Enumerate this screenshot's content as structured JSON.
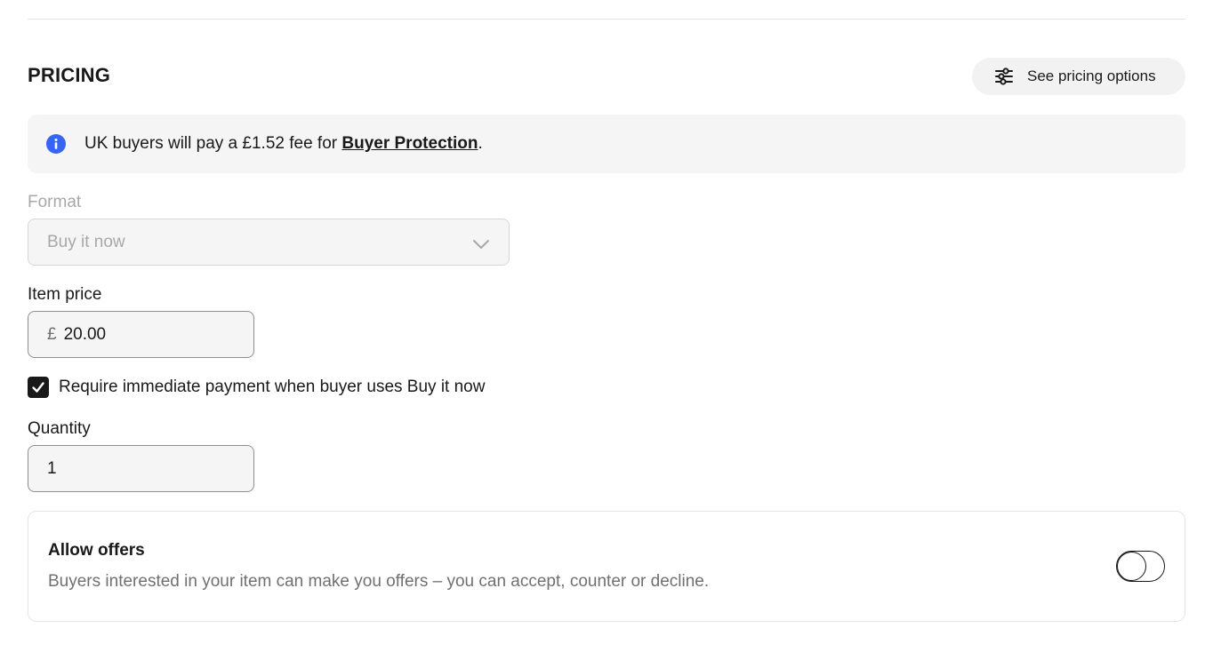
{
  "section": {
    "title": "PRICING",
    "pricing_options_label": "See pricing options",
    "pricing_options_icon": "sliders-icon"
  },
  "banner": {
    "icon": "info-icon",
    "text_before": "UK buyers will pay a £1.52 fee for ",
    "link_text": "Buyer Protection",
    "text_after": "."
  },
  "format": {
    "label": "Format",
    "value": "Buy it now",
    "icon": "chevron-down-icon"
  },
  "item_price": {
    "label": "Item price",
    "currency": "£",
    "value": "20.00"
  },
  "immediate_payment": {
    "label": "Require immediate payment when buyer uses Buy it now",
    "checked": true
  },
  "quantity": {
    "label": "Quantity",
    "value": "1"
  },
  "offers": {
    "title": "Allow offers",
    "description": "Buyers interested in your item can make you offers – you can accept, counter or decline.",
    "enabled": false
  },
  "colors": {
    "info_blue": "#3665f3",
    "text_primary": "#191919",
    "text_secondary": "#707070",
    "disabled": "#a8a8a8"
  }
}
